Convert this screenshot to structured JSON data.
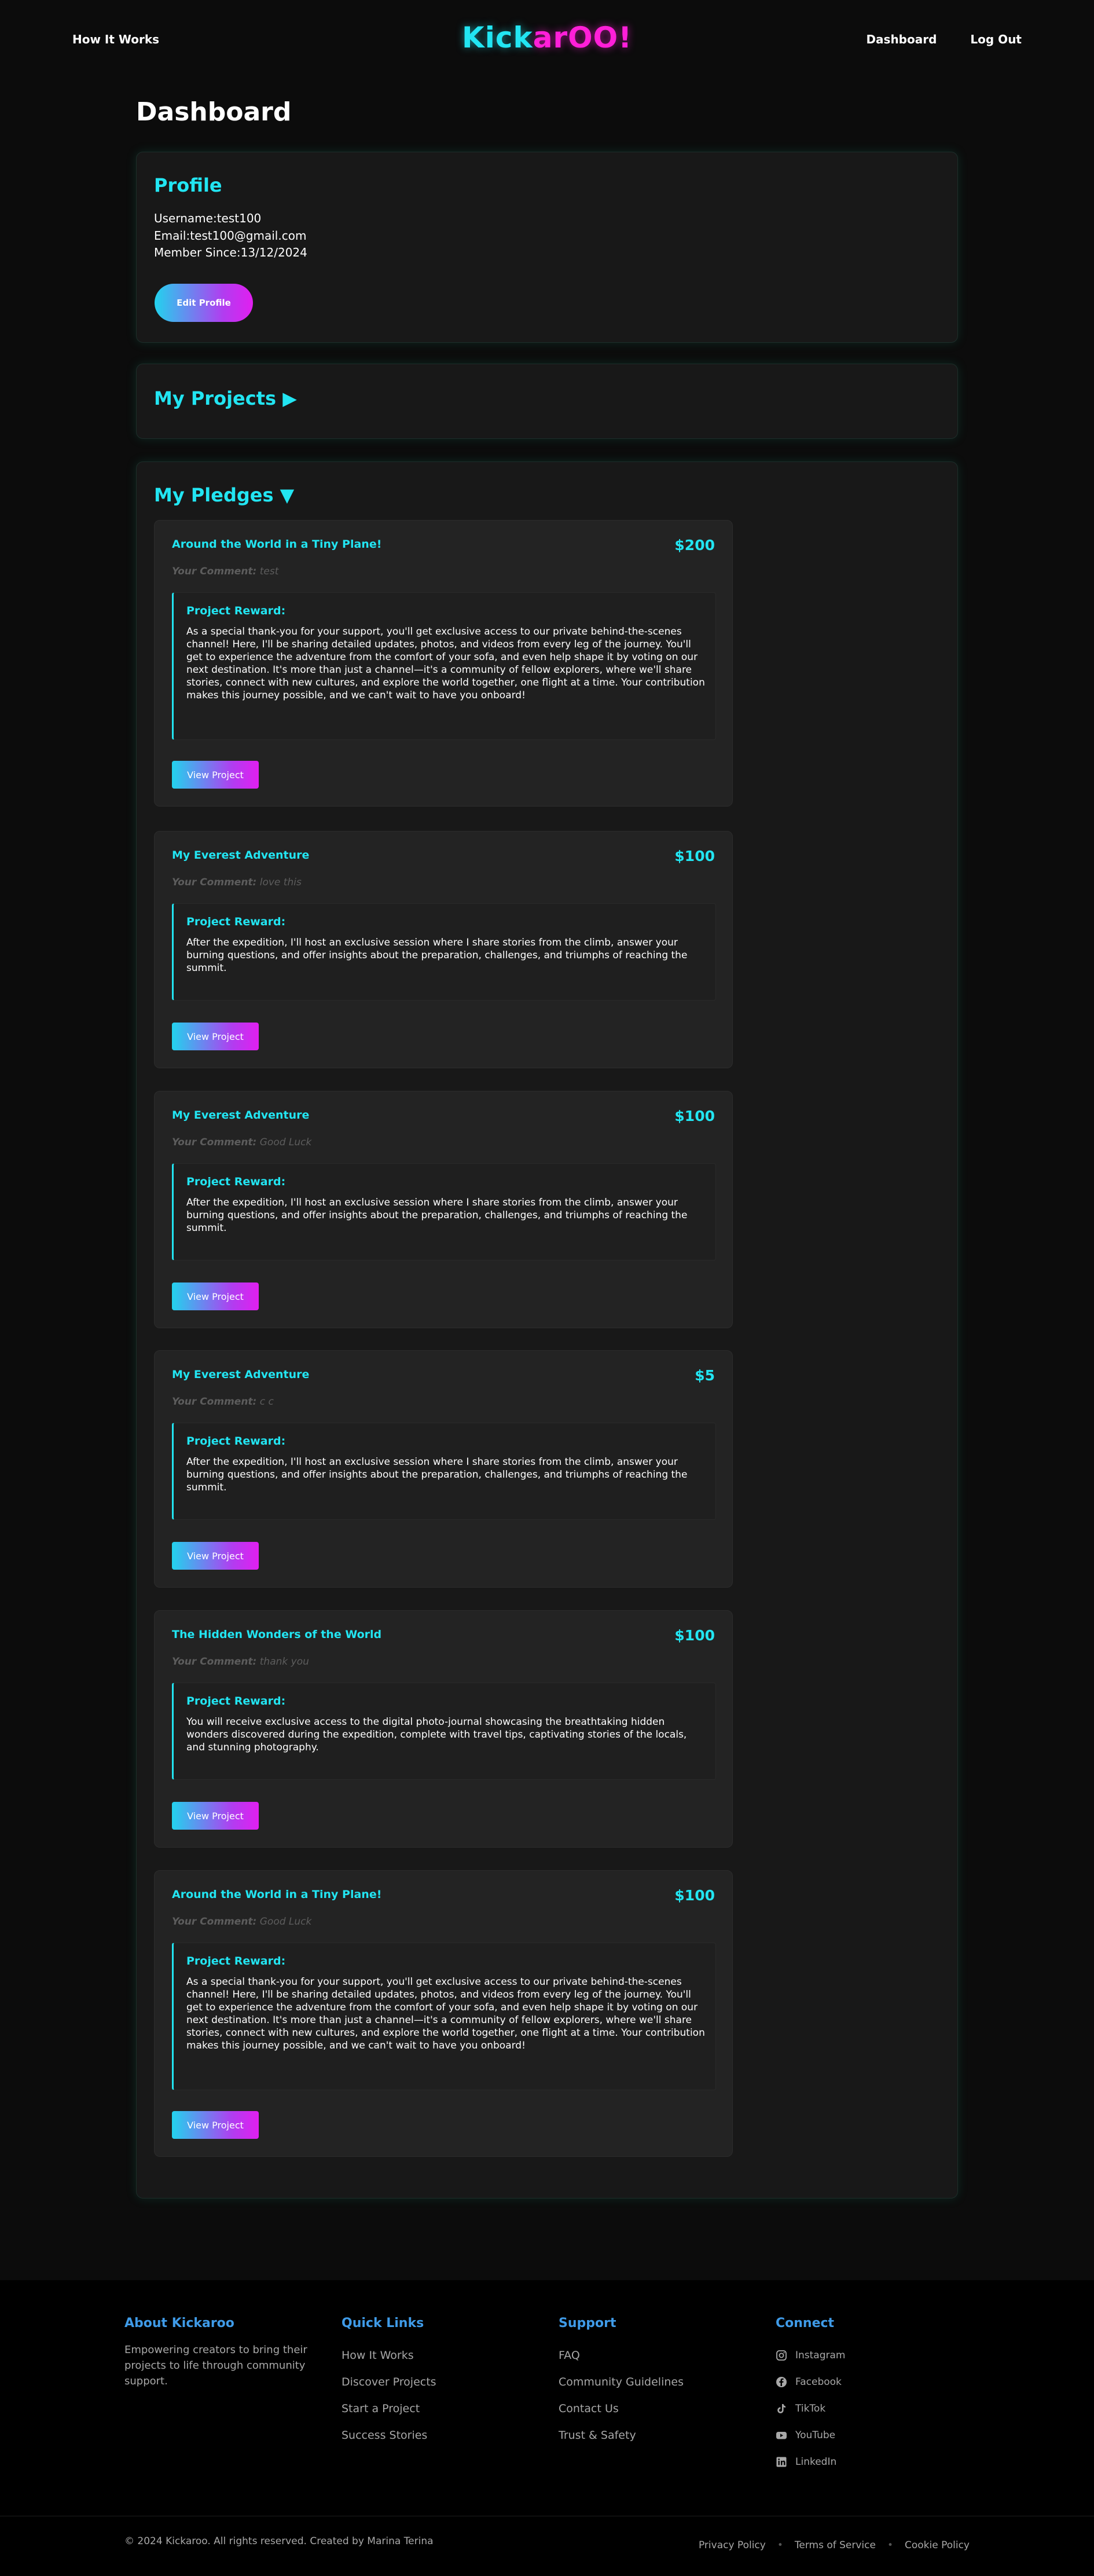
{
  "nav": {
    "how_it_works": "How It Works",
    "logo_part1": "Kick",
    "logo_part2": "arOO!",
    "dashboard": "Dashboard",
    "logout": "Log Out"
  },
  "page_title": "Dashboard",
  "profile": {
    "title": "Profile",
    "username": "Username:test100",
    "email": "Email:test100@gmail.com",
    "member_since": "Member Since:13/12/2024",
    "edit_button": "Edit Profile"
  },
  "projects": {
    "title": "My Projects ▶"
  },
  "pledges": {
    "title": "My Pledges ▼",
    "reward_label": "Project Reward:",
    "comment_label": "Your Comment:",
    "view_button": "View Project",
    "items": [
      {
        "title": "Around the World in a Tiny Plane!",
        "amount": "$200",
        "comment": "test",
        "reward": "As a special thank-you for your support, you'll get exclusive access to our private behind-the-scenes channel! Here, I'll be sharing detailed updates, photos, and videos from every leg of the journey. You'll get to experience the adventure from the comfort of your sofa, and even help shape it by voting on our next destination. It's more than just a channel—it's a community of fellow explorers, where we'll share stories, connect with new cultures, and explore the world together, one flight at a time. Your contribution makes this journey possible, and we can't wait to have you onboard!"
      },
      {
        "title": "My Everest Adventure",
        "amount": "$100",
        "comment": "love this",
        "reward": "After the expedition, I'll host an exclusive session where I share stories from the climb, answer your burning questions, and offer insights about the preparation, challenges, and triumphs of reaching the summit."
      },
      {
        "title": "My Everest Adventure",
        "amount": "$100",
        "comment": "Good Luck",
        "reward": "After the expedition, I'll host an exclusive session where I share stories from the climb, answer your burning questions, and offer insights about the preparation, challenges, and triumphs of reaching the summit."
      },
      {
        "title": "My Everest Adventure",
        "amount": "$5",
        "comment": "c c",
        "reward": "After the expedition, I'll host an exclusive session where I share stories from the climb, answer your burning questions, and offer insights about the preparation, challenges, and triumphs of reaching the summit."
      },
      {
        "title": "The Hidden Wonders of the World",
        "amount": "$100",
        "comment": "thank you",
        "reward": "You will receive exclusive access to the digital photo-journal showcasing the breathtaking hidden wonders discovered during the expedition, complete with travel tips, captivating stories of the locals, and stunning photography."
      },
      {
        "title": "Around the World in a Tiny Plane!",
        "amount": "$100",
        "comment": "Good Luck",
        "reward": "As a special thank-you for your support, you'll get exclusive access to our private behind-the-scenes channel! Here, I'll be sharing detailed updates, photos, and videos from every leg of the journey. You'll get to experience the adventure from the comfort of your sofa, and even help shape it by voting on our next destination. It's more than just a channel—it's a community of fellow explorers, where we'll share stories, connect with new cultures, and explore the world together, one flight at a time. Your contribution makes this journey possible, and we can't wait to have you onboard!"
      }
    ]
  },
  "footer": {
    "about": {
      "title": "About Kickaroo",
      "text": "Empowering creators to bring their projects to life through community support."
    },
    "quick_links": {
      "title": "Quick Links",
      "items": [
        "How It Works",
        "Discover Projects",
        "Start a Project",
        "Success Stories"
      ]
    },
    "support": {
      "title": "Support",
      "items": [
        "FAQ",
        "Community Guidelines",
        "Contact Us",
        "Trust & Safety"
      ]
    },
    "connect": {
      "title": "Connect",
      "items": [
        "Instagram",
        "Facebook",
        "TikTok",
        "YouTube",
        "LinkedIn"
      ]
    },
    "copyright": "© 2024 Kickaroo. All rights reserved. Created by Marina Terina",
    "legal": [
      "Privacy Policy",
      "Terms of Service",
      "Cookie Policy"
    ]
  },
  "colors": {
    "accent_cyan": "#22e5f2",
    "accent_magenta": "#ff1fd8",
    "footer_heading": "#3f9be8",
    "background": "#0c0c0c"
  }
}
